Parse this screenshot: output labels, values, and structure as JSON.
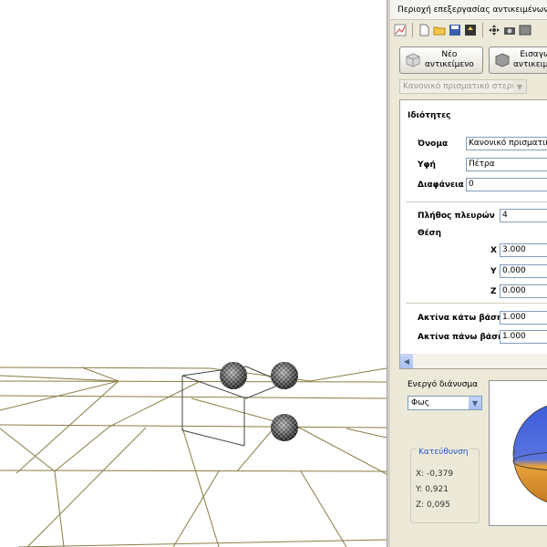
{
  "panel": {
    "title": "Περιοχή επεξεργασίας αντικειμένων",
    "new_object_button": "Νέο αντικείμενο",
    "new_object_line1": "Νέο",
    "new_object_line2": "αντικείμενο",
    "import_line1": "Εισαγωγή",
    "import_line2": "αντικειμένου",
    "shape_selector": "Κανονικό πρισματικό στερεό"
  },
  "properties": {
    "heading": "Ιδιότητες",
    "name_label": "Όνομα",
    "name_value": "Κανονικό πρισματικό στερεό",
    "texture_label": "Υφή",
    "texture_value": "Πέτρα",
    "transparency_label": "Διαφάνεια",
    "transparency_value": "0",
    "sides_label": "Πλήθος πλευρών",
    "sides_value": "4",
    "position_label": "Θέση",
    "x_label": "X",
    "x_value": "3.000",
    "y_label": "Y",
    "y_value": "0.000",
    "z_label": "Z",
    "z_value": "0.000",
    "bottom_radius_label": "Ακτίνα κάτω βάσης",
    "bottom_radius_value": "1.000",
    "top_radius_label": "Ακτίνα πάνω βάσης",
    "top_radius_value": "1.000"
  },
  "vector": {
    "active_label": "Ενεργό διάνυσμα",
    "selected": "Φως",
    "direction_title": "Κατεύθυνση",
    "x": "X: -0,379",
    "y": "Y: 0,921",
    "z": "Z: 0,095"
  },
  "colors": {
    "grid_line": "#8b7b44",
    "accent_blue": "#2457c4",
    "sphere_blue": "#3b5bd9",
    "sphere_orange": "#e8a13a"
  },
  "toolbar_icons": [
    "chart-icon",
    "new-file-icon",
    "open-folder-icon",
    "save-icon",
    "export-icon",
    "move-icon",
    "camera-icon",
    "view-icon"
  ]
}
